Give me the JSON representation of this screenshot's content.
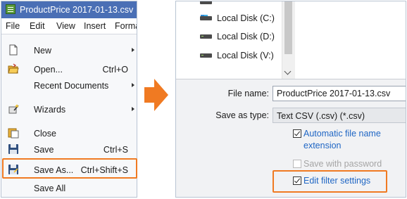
{
  "file_menu_window": {
    "title": "ProductPrice 2017-01-13.csv",
    "menubar": [
      "File",
      "Edit",
      "View",
      "Insert",
      "Forma"
    ],
    "menu_items": [
      {
        "label": "New",
        "accel": "",
        "submenu": true,
        "icon": "new-document-icon"
      },
      {
        "label": "Open...",
        "accel": "Ctrl+O",
        "submenu": false,
        "icon": "open-folder-icon"
      },
      {
        "label": "Recent Documents",
        "accel": "",
        "submenu": true,
        "icon": ""
      },
      {
        "label": "Wizards",
        "accel": "",
        "submenu": true,
        "icon": "wizard-wand-icon"
      },
      {
        "label": "Close",
        "accel": "",
        "submenu": false,
        "icon": "close-document-icon"
      },
      {
        "label": "Save",
        "accel": "Ctrl+S",
        "submenu": false,
        "icon": "save-floppy-icon"
      },
      {
        "label": "Save As...",
        "accel": "Ctrl+Shift+S",
        "submenu": false,
        "icon": "save-as-floppy-icon"
      },
      {
        "label": "Save All",
        "accel": "",
        "submenu": false,
        "icon": ""
      }
    ],
    "highlight_color": "#f07a22"
  },
  "save_dialog": {
    "drives": [
      "Local Disk (C:)",
      "Local Disk (D:)",
      "Local Disk (V:)"
    ],
    "file_name_label": "File name:",
    "file_name_value": "ProductPrice 2017-01-13.csv",
    "save_as_type_label": "Save as type:",
    "save_as_type_value": "Text CSV (.csv) (*.csv)",
    "checkboxes": [
      {
        "label": "Automatic file name extension",
        "checked": true,
        "enabled": true
      },
      {
        "label": "Save with password",
        "checked": false,
        "enabled": false
      },
      {
        "label": "Edit filter settings",
        "checked": true,
        "enabled": true
      }
    ]
  },
  "colors": {
    "title_bar": "#4a6fb5",
    "link_blue": "#1f66c4",
    "arrow_orange": "#f07a22"
  }
}
